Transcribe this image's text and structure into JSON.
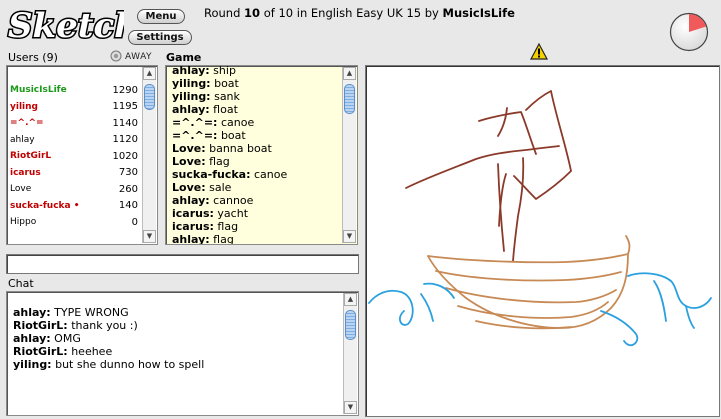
{
  "app": {
    "logo_text": "Sketch",
    "menu_label": "Menu",
    "settings_label": "Settings"
  },
  "round": {
    "prefix": "Round",
    "number": "10",
    "of_text": "of 10 in English Easy UK 15 by",
    "host": "MusicIsLife"
  },
  "timer": {
    "elapsed_fraction": 0.2,
    "color": "#f05a5a"
  },
  "users": {
    "header": "Users (9)",
    "away_label": "AWAY",
    "list": [
      {
        "name": "MusicIsLife",
        "score": "1290",
        "color": "#1a9a1a",
        "bold": true
      },
      {
        "name": "yiling",
        "score": "1195",
        "color": "#c00000",
        "bold": true
      },
      {
        "name": "=^.^=",
        "score": "1140",
        "color": "#c00000",
        "bold": true
      },
      {
        "name": "ahlay",
        "score": "1120",
        "color": "#000000",
        "bold": false
      },
      {
        "name": "RiotGirL",
        "score": "1020",
        "color": "#c00000",
        "bold": true
      },
      {
        "name": "icarus",
        "score": "730",
        "color": "#c00000",
        "bold": true
      },
      {
        "name": "Love",
        "score": "260",
        "color": "#000000",
        "bold": false
      },
      {
        "name": "sucka-fucka •",
        "score": "140",
        "color": "#c00000",
        "bold": true
      },
      {
        "name": "Hippo",
        "score": "0",
        "color": "#000000",
        "bold": false
      }
    ]
  },
  "game": {
    "header": "Game",
    "lines": [
      {
        "user": "ahlay:",
        "text": "ship"
      },
      {
        "user": "yiling:",
        "text": "boat"
      },
      {
        "user": "yiling:",
        "text": "sank"
      },
      {
        "user": "ahlay:",
        "text": "float"
      },
      {
        "user": "=^.^=:",
        "text": "canoe"
      },
      {
        "user": "=^.^=:",
        "text": "boat"
      },
      {
        "user": "Love:",
        "text": "banna boat"
      },
      {
        "user": "Love:",
        "text": "flag"
      },
      {
        "user": "sucka-fucka:",
        "text": "canoe"
      },
      {
        "user": "Love:",
        "text": "sale"
      },
      {
        "user": "ahlay:",
        "text": "cannoe"
      },
      {
        "user": "icarus:",
        "text": "yacht"
      },
      {
        "user": "icarus:",
        "text": "flag"
      },
      {
        "user": "ahlay:",
        "text": "flag"
      }
    ]
  },
  "guess_input": {
    "value": ""
  },
  "chat": {
    "header": "Chat",
    "lines": [
      {
        "user": "ahlay:",
        "text": "TYPE WRONG"
      },
      {
        "user": "RiotGirL:",
        "text": "thank you :)"
      },
      {
        "user": "ahlay:",
        "text": "OMG"
      },
      {
        "user": "RiotGirL:",
        "text": "heehee"
      },
      {
        "user": "yiling:",
        "text": "but she dunno how to spell"
      }
    ]
  },
  "canvas": {
    "stroke_colors": {
      "sail": "#8b3a2a",
      "hull": "#c88a55",
      "water": "#2aa0e0"
    }
  }
}
